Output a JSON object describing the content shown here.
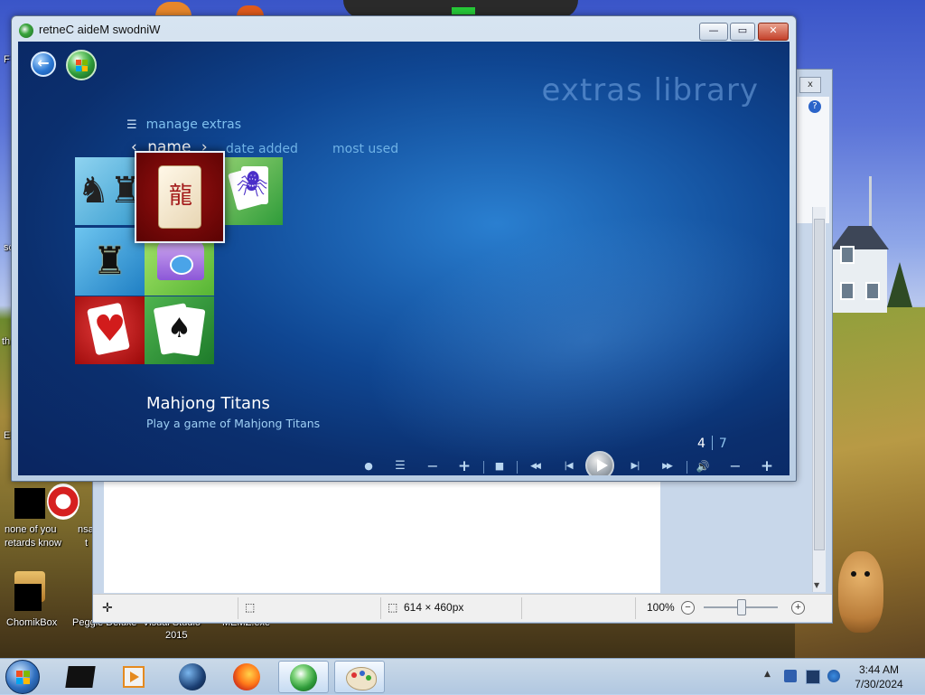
{
  "desktop": {
    "icons": [
      {
        "label": "none of you"
      },
      {
        "label": "retards know"
      },
      {
        "label": "ChomikBox"
      },
      {
        "label": "Peggle Deluxe"
      },
      {
        "label": "Visual Studio"
      },
      {
        "label": "2015"
      },
      {
        "label": "MEMZ.exe"
      }
    ],
    "edge_texts": [
      "F",
      "sc",
      "th",
      "Er",
      "nsa",
      "t"
    ]
  },
  "editor": {
    "close_glyph": "x",
    "help_glyph": "?",
    "status": {
      "dimensions": "614 × 460px",
      "zoom": "100%",
      "zoom_out": "−",
      "zoom_in": "+"
    },
    "scroll_down": "▼"
  },
  "wmc": {
    "window_title": "retneC aideM swodniW",
    "caption": {
      "minimize": "—",
      "maximize": "▭",
      "close": "✕"
    },
    "library_title": "extras library",
    "manage_label": "manage extras",
    "sort": {
      "current": "name",
      "prev_arrow": "‹",
      "next_arrow": "›",
      "options": [
        "date added",
        "most used"
      ]
    },
    "tiles": [
      {
        "name": "Chess Titans",
        "glyph": "♞♜"
      },
      {
        "name": "Mahjong Titans",
        "glyph": "🀄"
      },
      {
        "name": "Spider Solitaire",
        "glyph": "🕷"
      },
      {
        "name": "Media Center Studio",
        "glyph": "♜"
      },
      {
        "name": "Purble Place",
        "glyph": "🏠"
      },
      {
        "name": "Hearts",
        "glyph": "♥"
      },
      {
        "name": "Solitaire",
        "glyph": "♠"
      }
    ],
    "selected": {
      "title": "Mahjong Titans",
      "description": "Play a game of Mahjong Titans"
    },
    "pager": {
      "current": "4",
      "total": "7"
    },
    "transport": {
      "record": "●",
      "guide": "☰",
      "ch_down": "−",
      "ch_up": "+",
      "stop": "■",
      "rewind": "◀◀",
      "prev": "|◀",
      "next": "▶|",
      "ffwd": "▶▶",
      "volume": "🔊",
      "vol_down": "−",
      "vol_up": "+"
    }
  },
  "taskbar": {
    "time": "3:44 AM",
    "date": "7/30/2024",
    "tray_arrow": "▲"
  },
  "colors": {
    "wmc_background": "#0f4692",
    "wmc_accent": "#7fc0ef",
    "taskbar": "#c6dbf2"
  }
}
